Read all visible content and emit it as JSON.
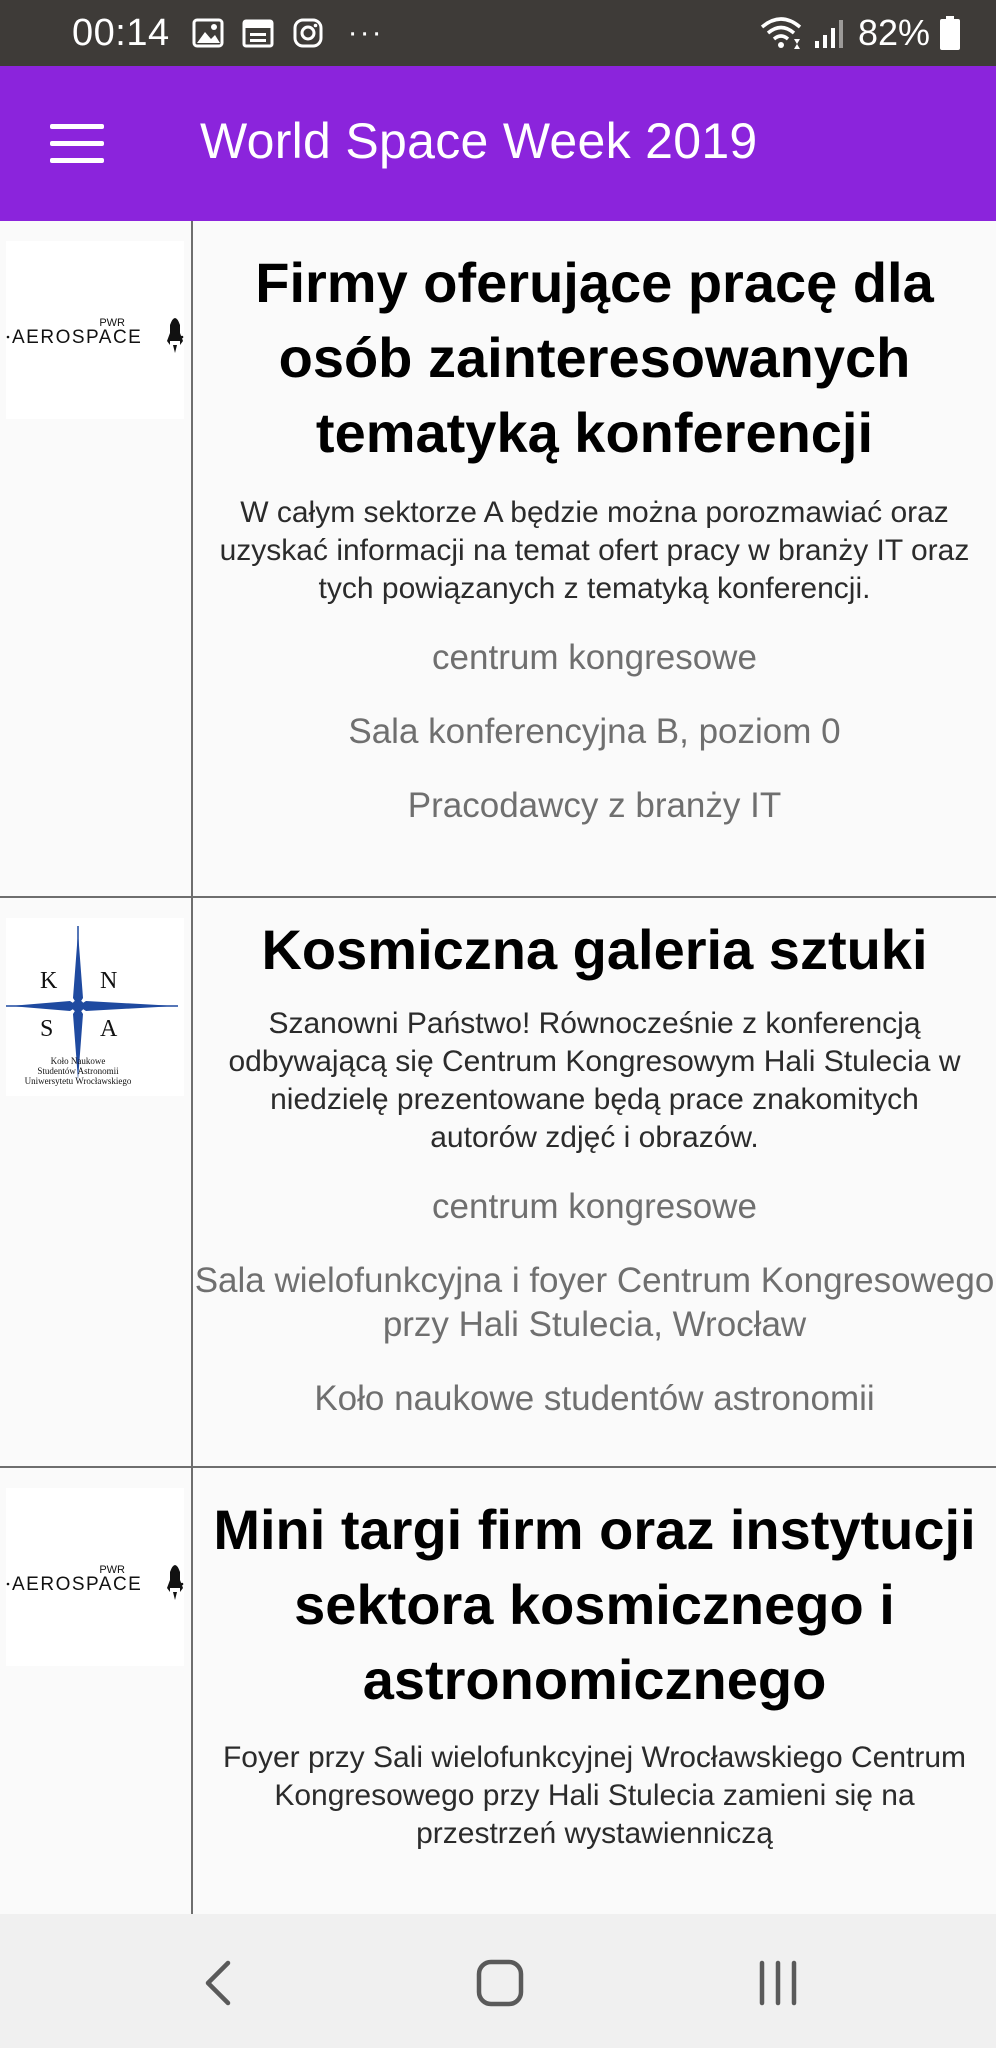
{
  "status_bar": {
    "time": "00:14",
    "battery": "82%",
    "more": "···",
    "left_icons": [
      "image-icon",
      "calendar-icon",
      "instagram-icon",
      "more-icon"
    ],
    "right_icons": [
      "wifi-icon",
      "signal-icon",
      "battery-icon"
    ]
  },
  "app_bar": {
    "title": "World Space Week 2019",
    "menu_icon": "hamburger-menu-icon",
    "color": "#8b24dc"
  },
  "events": [
    {
      "logo": "PWR Aerospace logo",
      "logo_text": "AEROSPACE",
      "logo_small": "PWR",
      "title": "Firmy oferujące pracę dla osób zainteresowanych tematyką konferencji",
      "description": "W całym sektorze A będzie można porozmawiać oraz uzyskać informacji na temat ofert pracy w branży IT oraz tych powiązanych z tematyką konferencji.",
      "category": "centrum kongresowe",
      "location": "Sala konferencyjna B, poziom 0",
      "organizer": "Pracodawcy z branży IT"
    },
    {
      "logo": "KNSA logo",
      "logo_letters": [
        "K",
        "N",
        "S",
        "A"
      ],
      "logo_caption": [
        "Koło Naukowe",
        "Studentów Astronomii",
        "Uniwersytetu Wrocławskiego"
      ],
      "title": "Kosmiczna galeria sztuki",
      "description": "Szanowni Państwo! Równocześnie z konferencją odbywającą się Centrum Kongresowym Hali Stulecia  w niedzielę prezentowane będą prace znakomitych autorów zdjęć i obrazów.",
      "category": "centrum kongresowe",
      "location": "Sala wielofunkcyjna i foyer Centrum Kongresowego przy Hali Stulecia, Wrocław",
      "organizer": "Koło naukowe studentów astronomii"
    },
    {
      "logo": "PWR Aerospace logo",
      "logo_text": "AEROSPACE",
      "logo_small": "PWR",
      "title": "Mini targi firm oraz instytucji sektora kosmicznego i astronomicznego",
      "description": "Foyer przy Sali wielofunkcyjnej Wrocławskiego Centrum Kongresowego przy Hali Stulecia zamieni się na przestrzeń wystawienniczą"
    }
  ],
  "nav_bar": {
    "icons": [
      "back-icon",
      "home-icon",
      "recent-apps-icon"
    ]
  }
}
